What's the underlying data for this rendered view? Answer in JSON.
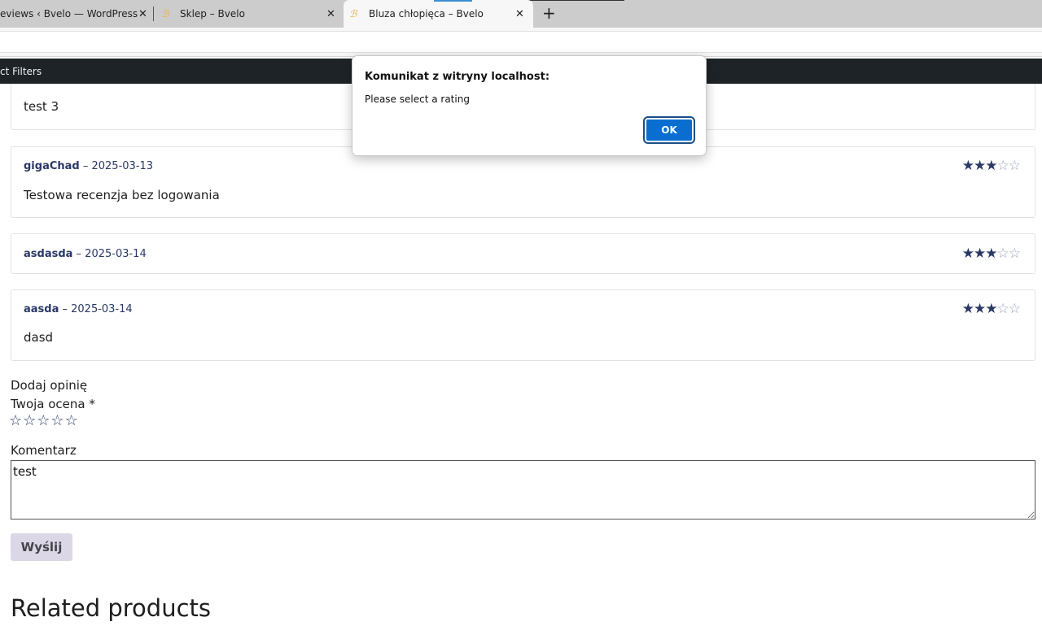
{
  "browser": {
    "tabs": [
      {
        "label": "eviews ‹ Bvelo — WordPress"
      },
      {
        "label": "Sklep – Bvelo"
      },
      {
        "label": "Bluza chłopięca – Bvelo",
        "active": true
      }
    ],
    "close_glyph": "✕",
    "new_tab_glyph": "+"
  },
  "adminbar": {
    "label": "ct Filters"
  },
  "reviews": [
    {
      "author": "",
      "date": "",
      "text": "test 3",
      "rating": 0
    },
    {
      "author": "gigaChad",
      "date": "2025-03-13",
      "text": "Testowa recenzja bez logowania",
      "rating": 3
    },
    {
      "author": "asdasda",
      "date": "2025-03-14",
      "text": "",
      "rating": 3
    },
    {
      "author": "aasda",
      "date": "2025-03-14",
      "text": "dasd",
      "rating": 3
    }
  ],
  "review_separator": " – ",
  "form": {
    "title": "Dodaj opinię",
    "rating_label": "Twoja ocena *",
    "rating_value": 0,
    "rating_max": 5,
    "comment_label": "Komentarz",
    "comment_value": "test",
    "submit_label": "Wyślij"
  },
  "related_heading": "Related products",
  "dialog": {
    "title": "Komunikat z witryny localhost:",
    "message": "Please select a rating",
    "ok_label": "OK"
  },
  "colors": {
    "star": "#2a3866",
    "admin_bar": "#1d2327",
    "dialog_button": "#0a6ed1",
    "submit_button": "#dcd7e6"
  }
}
